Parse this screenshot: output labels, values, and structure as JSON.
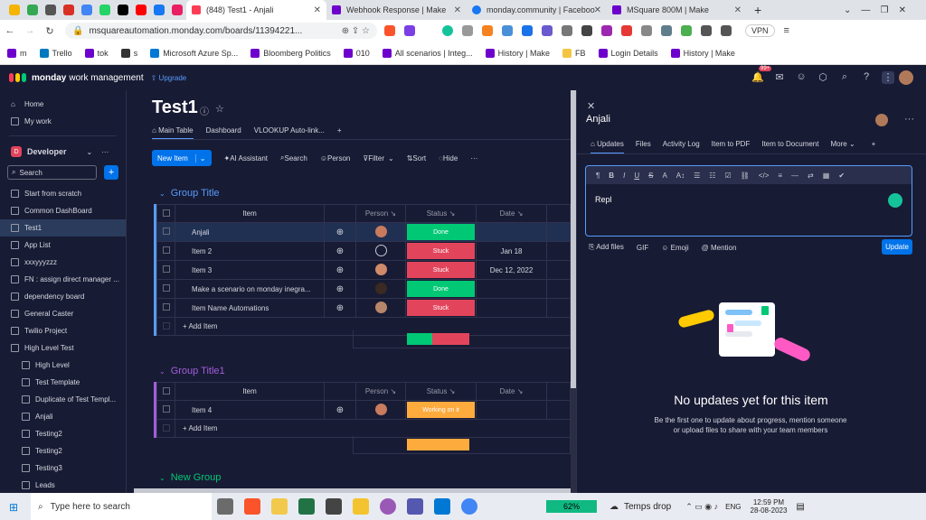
{
  "browser": {
    "tabs": [
      {
        "title": "(848) Test1 - Anjali",
        "active": true
      },
      {
        "title": "Webhook Response | Make",
        "active": false
      },
      {
        "title": "monday.community | Faceboo",
        "active": false
      },
      {
        "title": "MSquare 800M | Make",
        "active": false
      }
    ],
    "url": "msquareautomation.monday.com/boards/11394221...",
    "vpn_label": "VPN",
    "bookmarks": [
      "m",
      "Trello",
      "tok",
      "s",
      "Microsoft Azure Sp...",
      "Bloomberg Politics",
      "010",
      "All scenarios | Integ...",
      "History | Make",
      "FB",
      "Login Details",
      "History | Make"
    ]
  },
  "app": {
    "name": "monday",
    "subtitle": "work management",
    "upgrade": "Upgrade",
    "notif_count": "99+"
  },
  "sidebar": {
    "home": "Home",
    "my_work": "My work",
    "workspace_letter": "D",
    "workspace": "Developer",
    "search": "Search",
    "items": [
      {
        "label": "Start from scratch",
        "sel": false,
        "ind": false
      },
      {
        "label": "Common DashBoard",
        "sel": false,
        "ind": false
      },
      {
        "label": "Test1",
        "sel": true,
        "ind": false
      },
      {
        "label": "App List",
        "sel": false,
        "ind": false
      },
      {
        "label": "xxxyyyzzz",
        "sel": false,
        "ind": false
      },
      {
        "label": "FN : assign direct manager ...",
        "sel": false,
        "ind": false
      },
      {
        "label": "dependency board",
        "sel": false,
        "ind": false
      },
      {
        "label": "General Caster",
        "sel": false,
        "ind": false
      },
      {
        "label": "Twilio Project",
        "sel": false,
        "ind": false
      },
      {
        "label": "High Level Test",
        "sel": false,
        "ind": false
      },
      {
        "label": "High Level",
        "sel": false,
        "ind": true
      },
      {
        "label": "Test Template",
        "sel": false,
        "ind": true
      },
      {
        "label": "Duplicate of Test Templ...",
        "sel": false,
        "ind": true
      },
      {
        "label": "Anjali",
        "sel": false,
        "ind": true
      },
      {
        "label": "Testing2",
        "sel": false,
        "ind": true
      },
      {
        "label": "Testing2",
        "sel": false,
        "ind": true
      },
      {
        "label": "Testing3",
        "sel": false,
        "ind": true
      },
      {
        "label": "Leads",
        "sel": false,
        "ind": true
      }
    ]
  },
  "board": {
    "title": "Test1",
    "views": [
      "Main Table",
      "Dashboard",
      "VLOOKUP Auto-link...",
      "+"
    ],
    "toolbar": {
      "new_item": "New Item",
      "ai": "AI Assistant",
      "search": "Search",
      "person": "Person",
      "filter": "Filter",
      "sort": "Sort",
      "hide": "Hide"
    },
    "columns": {
      "item": "Item",
      "person": "Person",
      "status": "Status",
      "date": "Date"
    },
    "add_item": "+ Add Item",
    "groups": [
      {
        "title": "Group Title",
        "color": "#579bfc",
        "rows": [
          {
            "name": "Anjali",
            "status": "Done",
            "status_color": "#00c875",
            "date": ""
          },
          {
            "name": "Item 2",
            "status": "Stuck",
            "status_color": "#e2445c",
            "date": "Jan 18"
          },
          {
            "name": "Item 3",
            "status": "Stuck",
            "status_color": "#e2445c",
            "date": "Dec 12, 2022"
          },
          {
            "name": "Make a scenario on monday inegra...",
            "status": "Done",
            "status_color": "#00c875",
            "date": ""
          },
          {
            "name": "Item Name Automations",
            "status": "Stuck",
            "status_color": "#e2445c",
            "date": ""
          }
        ]
      },
      {
        "title": "Group Title1",
        "color": "#a25ddc",
        "rows": [
          {
            "name": "Item 4",
            "status": "Working on it",
            "status_color": "#fdab3d",
            "date": ""
          }
        ]
      }
    ],
    "new_group": "New Group"
  },
  "panel": {
    "title": "Anjali",
    "tabs": [
      "Updates",
      "Files",
      "Activity Log",
      "Item to PDF",
      "Item to Document",
      "More",
      "+"
    ],
    "editor_text": "Repl",
    "actions": [
      "Add files",
      "GIF",
      "Emoji",
      "Mention"
    ],
    "update_btn": "Update",
    "empty_title": "No updates yet for this item",
    "empty_line1": "Be the first one to update about progress, mention someone",
    "empty_line2": "or upload files to share with your team members"
  },
  "taskbar": {
    "search": "Type here to search",
    "battery": "62%",
    "weather": "Temps drop",
    "lang": "ENG",
    "time": "12:59 PM",
    "date": "28-08-2023"
  }
}
